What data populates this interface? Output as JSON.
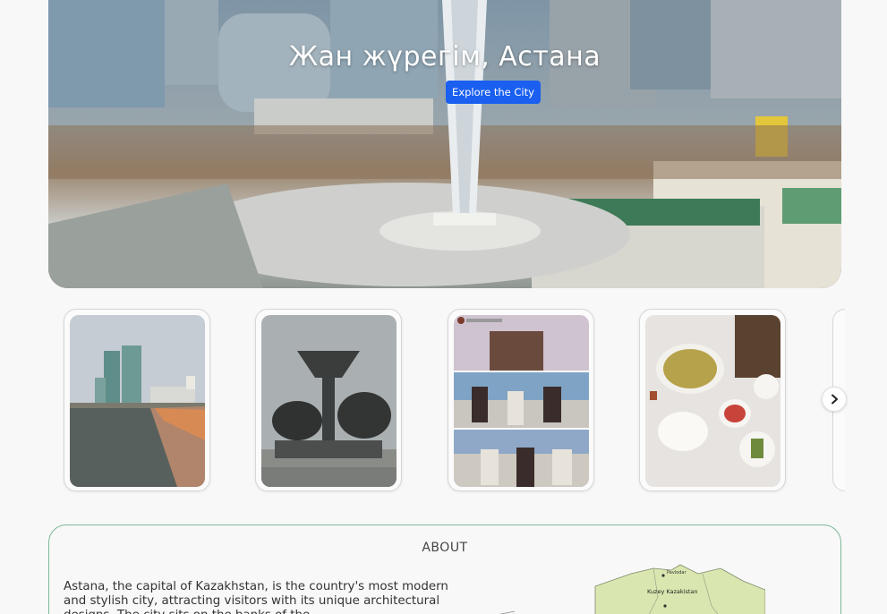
{
  "hero": {
    "title": "Жан жүрегім, Астана",
    "cta_label": "Explore the City"
  },
  "gallery": {
    "items": [
      {
        "name": "river-skyline-photo"
      },
      {
        "name": "horsemen-fountain-photo"
      },
      {
        "name": "folk-dance-collage-photo",
        "caption": "instagram.post"
      },
      {
        "name": "kazakh-dinner-table-photo"
      }
    ],
    "next_icon": "chevron-right-icon"
  },
  "about": {
    "heading": "ABOUT",
    "text": "Astana, the capital of Kazakhstan, is the country's most modern and stylish city, attracting visitors with its unique architectural designs. The city sits on the banks of the",
    "map_labels": [
      "Kuzey Kazakistan",
      "Pavlodar"
    ]
  },
  "colors": {
    "accent": "#1a5ff0",
    "about_border": "#7fb89b",
    "background": "#f8f8f8"
  }
}
